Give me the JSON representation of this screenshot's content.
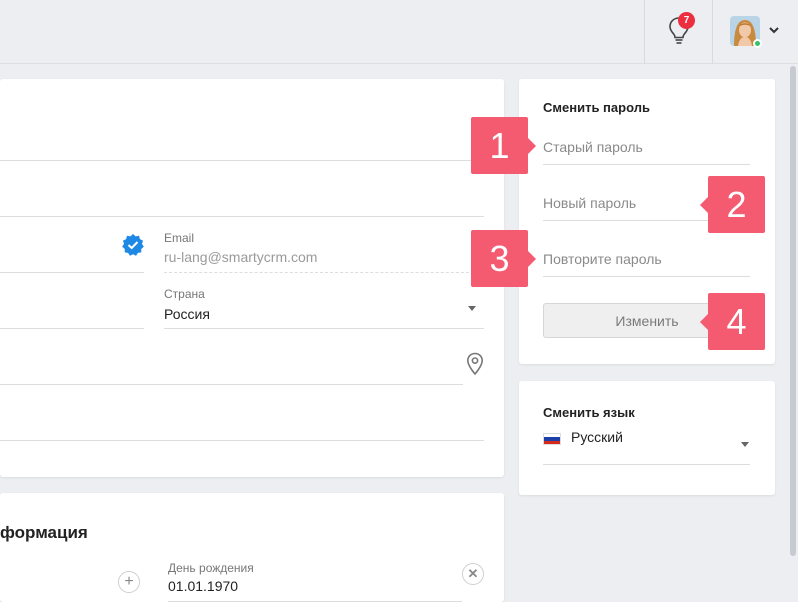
{
  "topbar": {
    "notifications_count": "7",
    "avatar_alt": "user-avatar"
  },
  "profile": {
    "email_label": "Email",
    "email_value": "ru-lang@smartycrm.com",
    "country_label": "Страна",
    "country_value": "Россия"
  },
  "extra_info": {
    "title_partial": "формация",
    "birthday_label": "День рождения",
    "birthday_value": "01.01.1970"
  },
  "password_card": {
    "title": "Сменить пароль",
    "old_password_placeholder": "Старый пароль",
    "new_password_placeholder": "Новый пароль",
    "repeat_password_placeholder": "Повторите пароль",
    "change_button": "Изменить"
  },
  "language_card": {
    "title": "Сменить язык",
    "selected_language": "Русский"
  },
  "markers": [
    "1",
    "2",
    "3",
    "4"
  ],
  "colors": {
    "marker": "#f45b70",
    "badge": "#ec2f3f",
    "verified": "#1e88e5",
    "online": "#31c46a"
  }
}
